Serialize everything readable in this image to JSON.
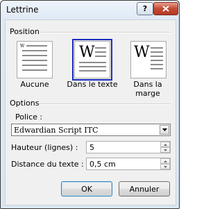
{
  "window": {
    "title": "Lettrine",
    "help_label": "?"
  },
  "position": {
    "section_label": "Position",
    "options": [
      {
        "label": "Aucune",
        "selected": false
      },
      {
        "label": "Dans le texte",
        "selected": true
      },
      {
        "label": "Dans la marge",
        "selected": false
      }
    ],
    "glyph": "W"
  },
  "options": {
    "section_label": "Options",
    "police_label": "Police :",
    "police_value": "Edwardian Script ITC",
    "hauteur_label": "Hauteur (lignes) :",
    "hauteur_value": "5",
    "distance_label": "Distance du texte :",
    "distance_value": "0,5 cm"
  },
  "buttons": {
    "ok": "OK",
    "cancel": "Annuler"
  },
  "colors": {
    "selection_outline": "#1b2bbd",
    "close_button": "#c44a34"
  }
}
